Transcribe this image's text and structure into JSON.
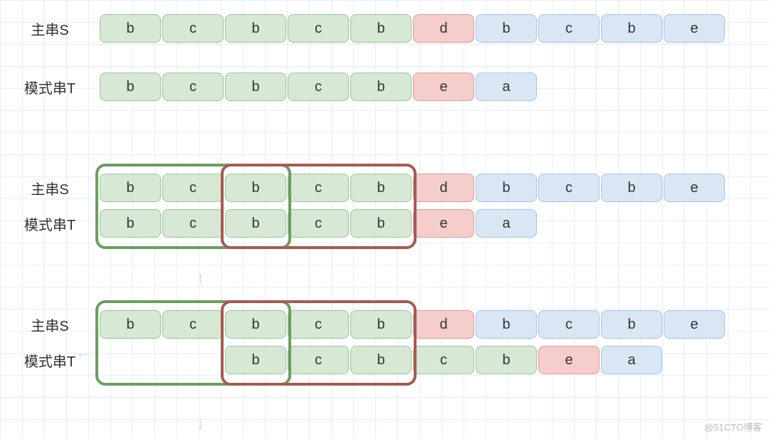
{
  "labels": {
    "mainS": "主串S",
    "patternT": "模式串T"
  },
  "rows": {
    "s1": [
      "b",
      "c",
      "b",
      "c",
      "b",
      "d",
      "b",
      "c",
      "b",
      "e"
    ],
    "t1": [
      "b",
      "c",
      "b",
      "c",
      "b",
      "e",
      "a"
    ],
    "s2": [
      "b",
      "c",
      "b",
      "c",
      "b",
      "d",
      "b",
      "c",
      "b",
      "e"
    ],
    "t2": [
      "b",
      "c",
      "b",
      "c",
      "b",
      "e",
      "a"
    ],
    "s3": [
      "b",
      "c",
      "b",
      "c",
      "b",
      "d",
      "b",
      "c",
      "b",
      "e"
    ],
    "t3": [
      "b",
      "c",
      "b",
      "c",
      "b",
      "e",
      "a"
    ]
  },
  "colors": {
    "s1": [
      "g",
      "g",
      "g",
      "g",
      "g",
      "r",
      "b",
      "b",
      "b",
      "b"
    ],
    "t1": [
      "g",
      "g",
      "g",
      "g",
      "g",
      "r",
      "b"
    ],
    "s2": [
      "g",
      "g",
      "g",
      "g",
      "g",
      "r",
      "b",
      "b",
      "b",
      "b"
    ],
    "t2": [
      "g",
      "g",
      "g",
      "g",
      "g",
      "r",
      "b"
    ],
    "s3": [
      "g",
      "g",
      "g",
      "g",
      "g",
      "r",
      "b",
      "b",
      "b",
      "b"
    ],
    "t3": [
      "g",
      "g",
      "g",
      "g",
      "g",
      "r",
      "b"
    ]
  },
  "watermark": "@51CTO博客"
}
